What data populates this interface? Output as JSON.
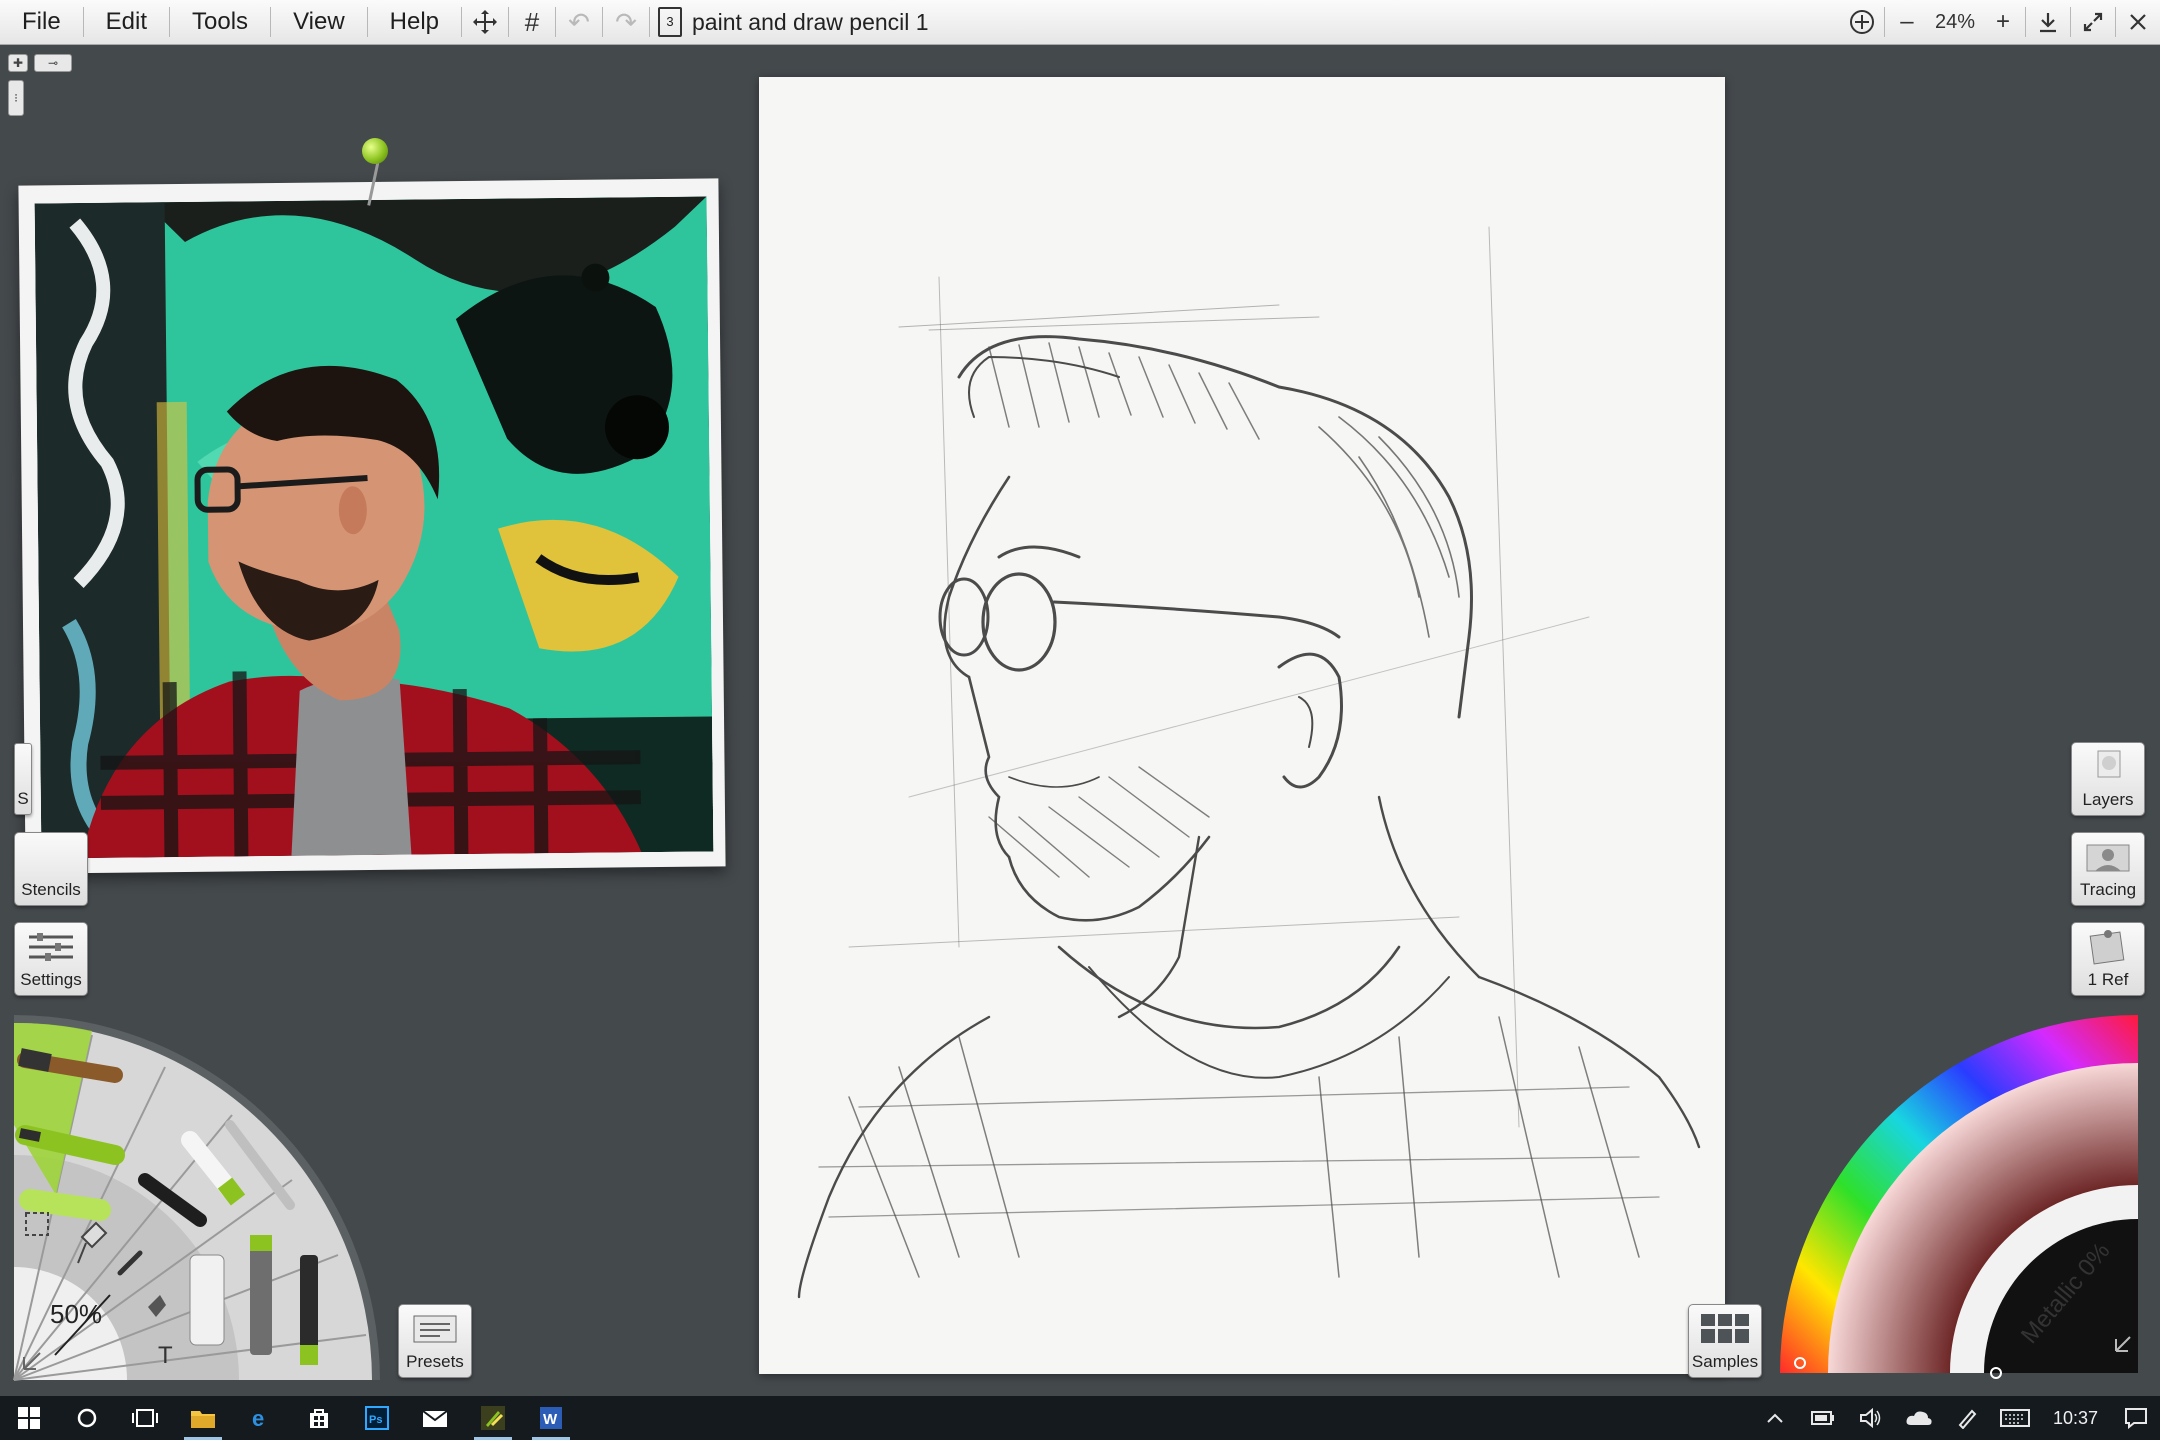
{
  "menu": {
    "file": "File",
    "edit": "Edit",
    "tools": "Tools",
    "view": "View",
    "help": "Help"
  },
  "document": {
    "page_number": "3",
    "title": "paint and draw pencil 1"
  },
  "toolbar": {
    "zoom_minus": "–",
    "zoom_value": "24%",
    "zoom_plus": "+",
    "icons": [
      "move-icon",
      "grid-icon",
      "undo-icon",
      "redo-icon",
      "refresh-icon",
      "download-icon",
      "fullscreen-icon",
      "close-icon"
    ]
  },
  "left_panel": {
    "stencils_label": "Stencils",
    "settings_label": "Settings",
    "partial_label": "S",
    "presets_label": "Presets",
    "tool_size": "50%",
    "text_tool_glyph": "T"
  },
  "right_panel": {
    "layers_label": "Layers",
    "tracing_label": "Tracing",
    "ref_label": "1 Ref",
    "samples_label": "Samples"
  },
  "color_picker": {
    "metallic_label": "Metallic 0%",
    "accent": "#8cc320"
  },
  "taskbar": {
    "clock": "10:37",
    "apps": [
      "start-icon",
      "search-icon",
      "task-view-icon",
      "file-explorer-icon",
      "edge-icon",
      "store-icon",
      "photoshop-icon",
      "mail-icon",
      "artrage-icon",
      "word-icon"
    ]
  },
  "colors": {
    "background": "#44494c",
    "menubar": "#f0f0f0",
    "taskbar": "#151a1f",
    "brand_green": "#8cc320"
  }
}
